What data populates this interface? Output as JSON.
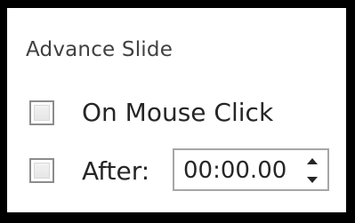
{
  "group": {
    "title": "Advance Slide"
  },
  "on_click": {
    "label": "On Mouse Click",
    "checked": false
  },
  "after": {
    "label": "After:",
    "checked": false,
    "time_value": "00:00.00"
  },
  "icons": {
    "spin_up": "caret-up-icon",
    "spin_down": "caret-down-icon"
  }
}
